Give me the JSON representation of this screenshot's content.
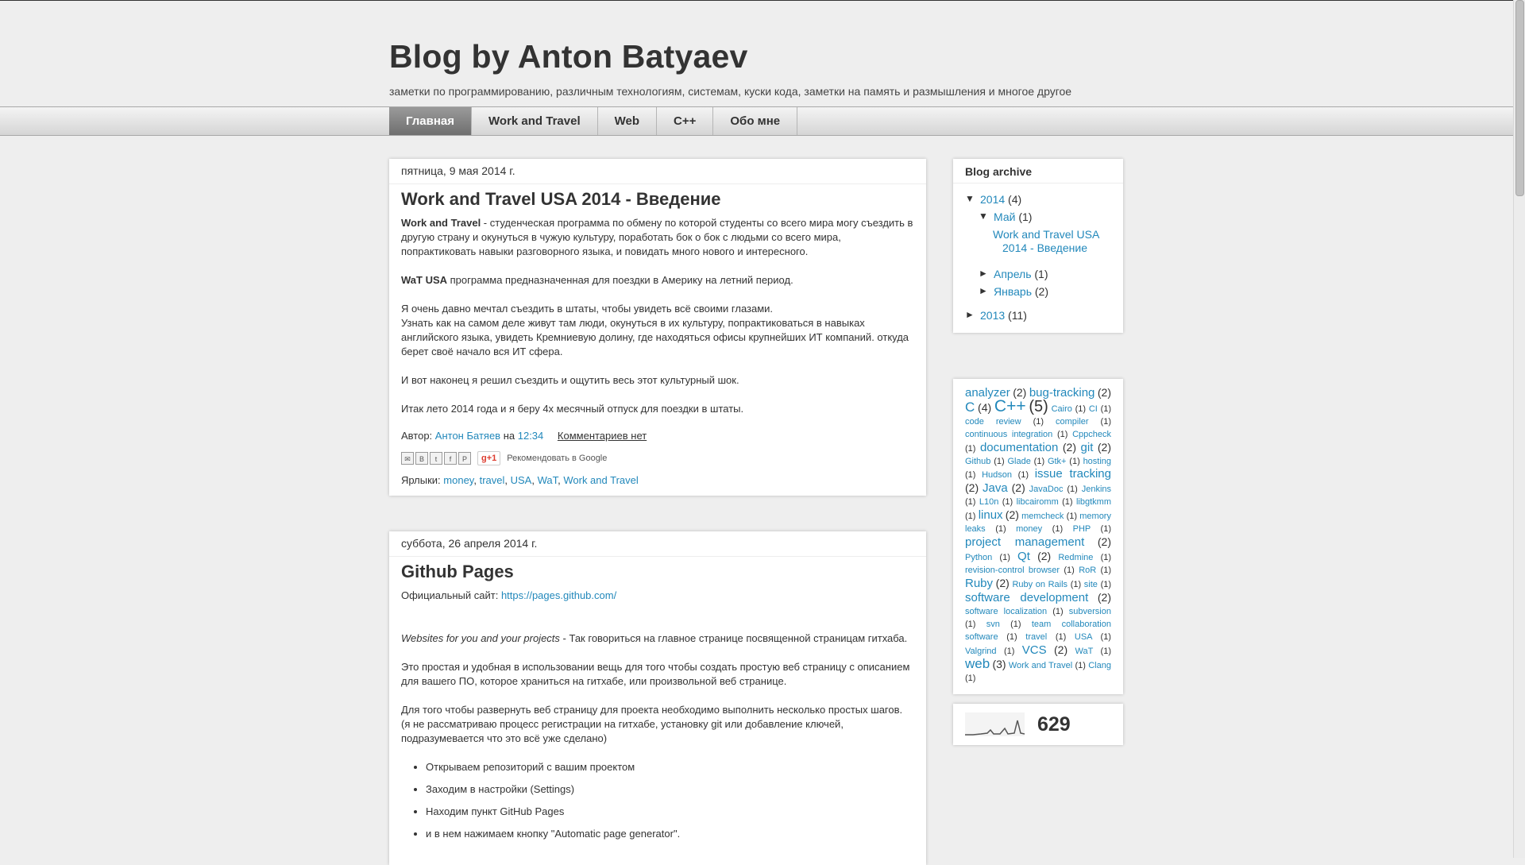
{
  "header": {
    "title": "Blog by Anton Batyaev",
    "description": "заметки по программированию, различным технологиям, системам, куски кода, заметки на память и размышления и многое другое"
  },
  "tabs": [
    {
      "label": "Главная",
      "active": true
    },
    {
      "label": "Work and Travel",
      "active": false
    },
    {
      "label": "Web",
      "active": false
    },
    {
      "label": "C++",
      "active": false
    },
    {
      "label": "Обо мне",
      "active": false
    }
  ],
  "post1": {
    "date": "пятница, 9 мая 2014 г.",
    "title": "Work and Travel USA 2014 - Введение",
    "p1_bold": "Work and Travel",
    "p1_text": " - студенческая программа по обмену по которой студенты со всего мира могу съездить в другую страну и окунуться в чужую культуру, поработать бок о бок с людьми со всего мира, попрактиковать навыки разговорного языка, и повидать много нового и интересного.",
    "p2_bold": "WaT USA",
    "p2_text": " программа предназначенная для поездки в Америку на летний период.",
    "p3_line1": "Я очень давно мечтал съездить в штаты, чтобы увидеть всё своими глазами.",
    "p3_line2": "Узнать как на самом деле живут там люди, окунуться в их культуру, попрактиковаться в навыках английского языка, увидеть Кремниевую долину, где находяться офисы крупнейших ИТ компаний. откуда берет своё начало вся ИТ сфера.",
    "p4": "И вот наконец я решил съездить и ощутить весь этот культурный шок.",
    "p5": "Итак лето 2014 года и я беру 4х месячный отпуск для поездки в штаты.",
    "author_prefix": "Автор: ",
    "author": "Антон Батяев",
    "at": " на ",
    "time": "12:34",
    "comments": "Комментариев нет",
    "gplus": "g+1",
    "recommend": "Рекомендовать в Google",
    "labels_prefix": "Ярлыки: ",
    "labels": [
      "money",
      "travel",
      "USA",
      "WaT",
      "Work and Travel"
    ]
  },
  "post2": {
    "date": "суббота, 26 апреля 2014 г.",
    "title": "Github Pages",
    "site_prefix": "Официальный сайт: ",
    "site_url": "https://pages.github.com/",
    "p1_italic": "Websites for you and your projects",
    "p1_text": " - Так говориться на главное странице посвященной страницам гитхаба.",
    "p2": "Это простая и удобная в использовании вещь для того чтобы создать простую веб страницу с описанием для вашего ПО, которое храниться на гитхабе, или произвольной веб странице.",
    "p3_line1": "Для того чтобы развернуть веб страницу для проекта необходимо выполнить несколько простых шагов.",
    "p3_line2": "(я не рассматриваю процесс регистрации на гитхабе, установку git или добавление ключей, подразумевается что это всё уже сделано)",
    "steps": [
      "Открываем репозиторий с вашим проектом",
      " Заходим в настройки (Settings)",
      "Находим пункт GitHub Pages",
      "и в нем нажимаем кнопку \"Automatic page generator\"."
    ]
  },
  "archive": {
    "title": "Blog archive",
    "y2014": {
      "label": "2014",
      "count": "(4)",
      "toggle": "▼"
    },
    "may": {
      "label": "Май",
      "count": "(1)",
      "toggle": "▼"
    },
    "may_post": "Work and Travel USA 2014 - Введение",
    "april": {
      "label": "Апрель",
      "count": "(1)",
      "toggle": "►"
    },
    "january": {
      "label": "Январь",
      "count": "(2)",
      "toggle": "►"
    },
    "y2013": {
      "label": "2013",
      "count": "(11)",
      "toggle": "►"
    }
  },
  "tags": [
    {
      "name": "analyzer",
      "count": "(2)",
      "size": 15
    },
    {
      "name": "bug-tracking",
      "count": "(2)",
      "size": 15
    },
    {
      "name": "C",
      "count": "(4)",
      "size": 17
    },
    {
      "name": "C++",
      "count": "(5)",
      "size": 21
    },
    {
      "name": "Cairo",
      "count": "(1)",
      "size": 11
    },
    {
      "name": "CI",
      "count": "(1)",
      "size": 11
    },
    {
      "name": "code review",
      "count": "(1)",
      "size": 11
    },
    {
      "name": "compiler",
      "count": "(1)",
      "size": 11
    },
    {
      "name": "continuous integration",
      "count": "(1)",
      "size": 11
    },
    {
      "name": "Cppcheck",
      "count": "(1)",
      "size": 11
    },
    {
      "name": "documentation",
      "count": "(2)",
      "size": 15
    },
    {
      "name": "git",
      "count": "(2)",
      "size": 15
    },
    {
      "name": "Github",
      "count": "(1)",
      "size": 11
    },
    {
      "name": "Glade",
      "count": "(1)",
      "size": 11
    },
    {
      "name": "Gtk+",
      "count": "(1)",
      "size": 11
    },
    {
      "name": "hosting",
      "count": "(1)",
      "size": 11
    },
    {
      "name": "Hudson",
      "count": "(1)",
      "size": 11
    },
    {
      "name": "issue tracking",
      "count": "(2)",
      "size": 15
    },
    {
      "name": "Java",
      "count": "(2)",
      "size": 15
    },
    {
      "name": "JavaDoc",
      "count": "(1)",
      "size": 11
    },
    {
      "name": "Jenkins",
      "count": "(1)",
      "size": 11
    },
    {
      "name": "L10n",
      "count": "(1)",
      "size": 11
    },
    {
      "name": "libcairomm",
      "count": "(1)",
      "size": 11
    },
    {
      "name": "libgtkmm",
      "count": "(1)",
      "size": 11
    },
    {
      "name": "linux",
      "count": "(2)",
      "size": 15
    },
    {
      "name": "memcheck",
      "count": "(1)",
      "size": 11
    },
    {
      "name": "memory leaks",
      "count": "(1)",
      "size": 11
    },
    {
      "name": "money",
      "count": "(1)",
      "size": 11
    },
    {
      "name": "PHP",
      "count": "(1)",
      "size": 11
    },
    {
      "name": "project management",
      "count": "(2)",
      "size": 15
    },
    {
      "name": "Python",
      "count": "(1)",
      "size": 11
    },
    {
      "name": "Qt",
      "count": "(2)",
      "size": 15
    },
    {
      "name": "Redmine",
      "count": "(1)",
      "size": 11
    },
    {
      "name": "revision-control browser",
      "count": "(1)",
      "size": 11
    },
    {
      "name": "RoR",
      "count": "(1)",
      "size": 11
    },
    {
      "name": "Ruby",
      "count": "(2)",
      "size": 15
    },
    {
      "name": "Ruby on Rails",
      "count": "(1)",
      "size": 11
    },
    {
      "name": "site",
      "count": "(1)",
      "size": 11
    },
    {
      "name": "software development",
      "count": "(2)",
      "size": 15
    },
    {
      "name": "software localization",
      "count": "(1)",
      "size": 11
    },
    {
      "name": "subversion",
      "count": "(1)",
      "size": 11
    },
    {
      "name": "svn",
      "count": "(1)",
      "size": 11
    },
    {
      "name": "team collaboration software",
      "count": "(1)",
      "size": 11
    },
    {
      "name": "travel",
      "count": "(1)",
      "size": 11
    },
    {
      "name": "USA",
      "count": "(1)",
      "size": 11
    },
    {
      "name": "Valgrind",
      "count": "(1)",
      "size": 11
    },
    {
      "name": "VCS",
      "count": "(2)",
      "size": 15
    },
    {
      "name": "WaT",
      "count": "(1)",
      "size": 11
    },
    {
      "name": "web",
      "count": "(3)",
      "size": 17
    },
    {
      "name": "Work and Travel",
      "count": "(1)",
      "size": 11
    },
    {
      "name": "Clang",
      "count": "(1)",
      "size": 11
    }
  ],
  "stats": {
    "pageviews": "629"
  }
}
